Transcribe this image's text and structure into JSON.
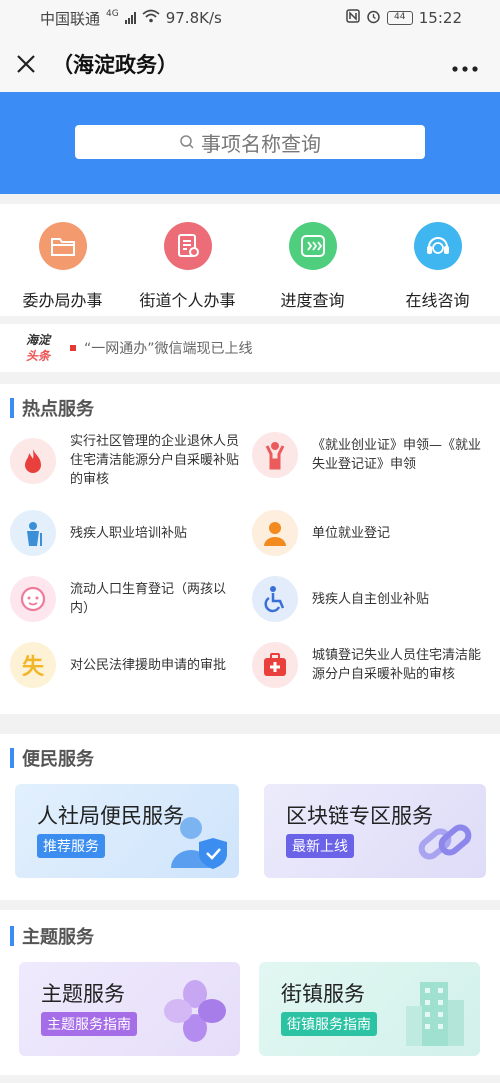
{
  "status": {
    "carrier": "中国联通",
    "network": "4G",
    "speed": "97.8K/s",
    "battery": "44",
    "time": "15:22"
  },
  "titlebar": {
    "title": "（海淀政务）"
  },
  "search": {
    "placeholder": "事项名称查询"
  },
  "quick": [
    {
      "label": "委办局办事",
      "color": "#f39a6e",
      "icon": "folder-icon"
    },
    {
      "label": "街道个人办事",
      "color": "#ec6d78",
      "icon": "document-icon"
    },
    {
      "label": "进度查询",
      "color": "#4fcf7e",
      "icon": "progress-icon"
    },
    {
      "label": "在线咨询",
      "color": "#40b6f0",
      "icon": "headset-icon"
    }
  ],
  "news": {
    "logo_top": "海淀",
    "logo_bottom": "头条",
    "text": "“一网通办”微信端现已上线"
  },
  "hot": {
    "title": "热点服务",
    "items": [
      {
        "text": "实行社区管理的企业退休人员住宅清洁能源分户自采暖补贴的审核",
        "icon": "flame-icon",
        "color": "#e9403d"
      },
      {
        "text": "《就业创业证》申领—《就业失业登记证》申领",
        "icon": "person-icon",
        "color": "#ec5b5b"
      },
      {
        "text": "残疾人职业培训补贴",
        "icon": "elderly-icon",
        "color": "#3a8fd6"
      },
      {
        "text": "单位就业登记",
        "icon": "worker-icon",
        "color": "#f28a1e"
      },
      {
        "text": "流动人口生育登记（两孩以内）",
        "icon": "baby-icon",
        "color": "#ef7a9a"
      },
      {
        "text": "残疾人自主创业补贴",
        "icon": "wheelchair-icon",
        "color": "#3a6fd6"
      },
      {
        "text": "对公民法律援助申请的审批",
        "icon": "shi-icon",
        "glyph": "失",
        "color": "#f1b729"
      },
      {
        "text": "城镇登记失业人员住宅清洁能源分户自采暖补贴的审核",
        "icon": "medkit-icon",
        "color": "#e9403d"
      }
    ]
  },
  "convenience": {
    "title": "便民服务",
    "cards": [
      {
        "title": "人社局便民服务",
        "tag": "推荐服务",
        "tag_color": "#3b8ef0",
        "icon": "user-shield-icon"
      },
      {
        "title": "区块链专区服务",
        "tag": "最新上线",
        "tag_color": "#6a63e8",
        "icon": "chain-icon"
      }
    ]
  },
  "theme": {
    "title": "主题服务",
    "cards": [
      {
        "title": "主题服务",
        "tag": "主题服务指南",
        "tag_color": "#a66de8",
        "icon": "clover-icon"
      },
      {
        "title": "街镇服务",
        "tag": "街镇服务指南",
        "tag_color": "#2bc3a4",
        "icon": "building-icon"
      }
    ]
  }
}
